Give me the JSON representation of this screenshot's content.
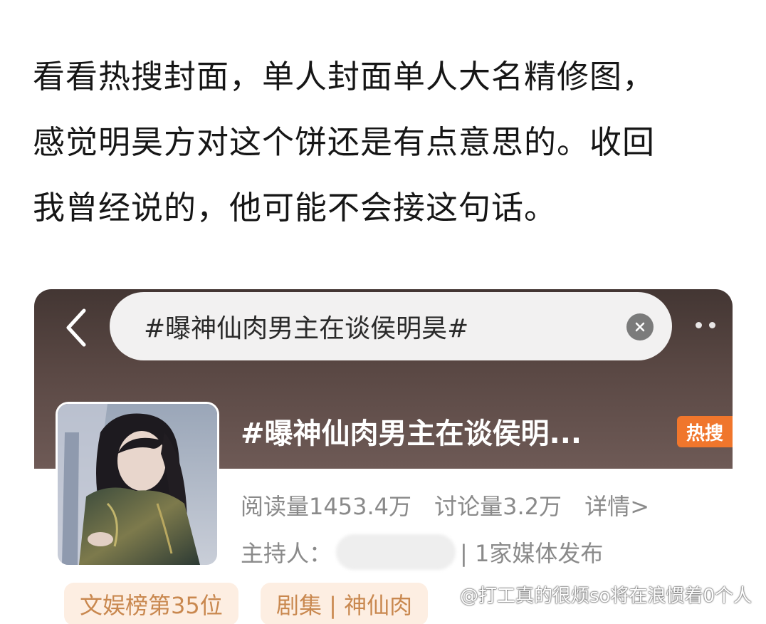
{
  "post": {
    "lines": [
      "看看热搜封面，单人封面单人大名精修图，",
      "感觉明昊方对这个饼还是有点意思的。收回",
      "我曾经说的，他可能不会接这句话。"
    ]
  },
  "card": {
    "search_query": "#曝神仙肉男主在谈侯明昊#",
    "topic_title": "#曝神仙肉男主在谈侯明...",
    "hot_badge": "热搜",
    "stats": {
      "reads": "阅读量1453.4万",
      "discussions": "讨论量3.2万",
      "details": "详情>"
    },
    "host_label": "主持人：",
    "media_count": "| 1家媒体发布",
    "tags": [
      "文娱榜第35位",
      "剧集 | 神仙肉"
    ]
  },
  "watermark": "@打工真的很烦so将在浪惯着0个人",
  "colors": {
    "header_bg": "#5a4844",
    "hot_badge": "#f0762c",
    "tag_bg": "#fdeee2",
    "tag_text": "#c9884f"
  }
}
